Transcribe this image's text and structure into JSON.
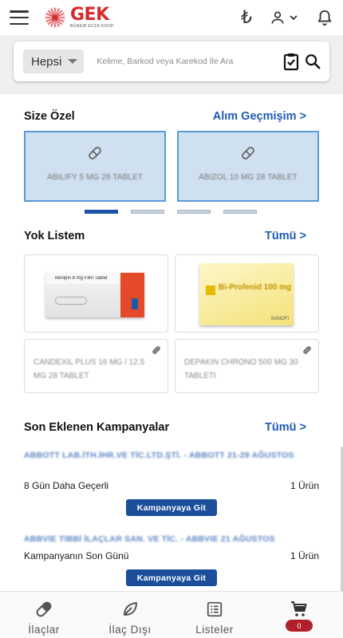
{
  "brand": {
    "name": "GEK",
    "subtitle": "BÜNEW ECZA KOOP"
  },
  "header": {
    "currency_symbol": "₺"
  },
  "search": {
    "filter_value": "Hepsi",
    "placeholder": "Kelime, Barkod veya Karekod İle Ara"
  },
  "special": {
    "title": "Size Özel",
    "link": "Alım Geçmişim >",
    "items": [
      {
        "name": "ABILIFY 5 MG 28 TABLET"
      },
      {
        "name": "ABIZOL 10 MG 28 TABLET"
      }
    ],
    "carousel_pages": 4,
    "carousel_active": 1
  },
  "missing_list": {
    "title": "Yok Listem",
    "link": "Tümü >",
    "products": [
      {
        "name": "Benipin 8 mg Film Tablet"
      },
      {
        "name": "Bi-Profenid 100 mg",
        "maker": "SANOFI"
      },
      {
        "name": "CANDEXIL PLUS 16 MG / 12.5 MG 28 TABLET"
      },
      {
        "name": "DEPAKIN CHRONO 500 MG 30 TABLETI"
      }
    ]
  },
  "campaigns": {
    "title": "Son Eklenen Kampanyalar",
    "link": "Tümü >",
    "items": [
      {
        "title": "ABBOTT LAB.İTH.İHR.VE TİC.LTD.ŞTİ. - ABBOTT 21-29 AĞUSTOS",
        "status": "8 Gün Daha Geçerli",
        "count": "1 Ürün",
        "button": "Kampanyaya Git"
      },
      {
        "title": "ABBVIE TIBBİ İLAÇLAR SAN. VE TİC. - ABBVIE 21 AĞUSTOS",
        "status": "Kampanyanın Son Günü",
        "count": "1 Ürün",
        "button": "Kampanyaya Git"
      }
    ]
  },
  "bottom_nav": {
    "items": [
      {
        "label": "İlaçlar",
        "icon": "pill-icon"
      },
      {
        "label": "İlaç Dışı",
        "icon": "leaf-icon"
      },
      {
        "label": "Listeler",
        "icon": "list-icon"
      },
      {
        "label": "",
        "icon": "cart-icon"
      }
    ],
    "cart_count": "0"
  },
  "colors": {
    "accent": "#1f5bb5",
    "brand_red": "#d52b2b",
    "button_blue": "#1b4f9c",
    "badge_red": "#b0202a"
  }
}
